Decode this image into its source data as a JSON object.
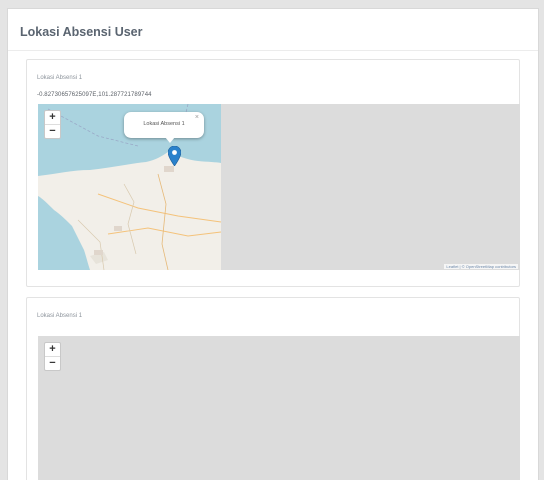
{
  "page": {
    "title": "Lokasi Absensi User"
  },
  "cards": [
    {
      "label": "Lokasi Absensi 1",
      "coordinates": "-0.82730657625097E,101.287721789744",
      "map": {
        "zoom_in": "+",
        "zoom_out": "−",
        "popup_text": "Lokasi Absensi 1",
        "popup_close": "×",
        "attribution": "Leaflet | © OpenStreetMap contributors"
      }
    },
    {
      "label": "Lokasi Absensi 1",
      "map": {
        "zoom_in": "+",
        "zoom_out": "−"
      }
    }
  ],
  "colors": {
    "sea": "#aad3df",
    "land": "#f2efe9",
    "map_bg": "#dcdcdc",
    "marker": "#2a81cb",
    "title": "#5a6470"
  },
  "icons": {
    "marker": "map-marker-icon",
    "zoom_in": "plus-icon",
    "zoom_out": "minus-icon",
    "close": "close-icon"
  }
}
